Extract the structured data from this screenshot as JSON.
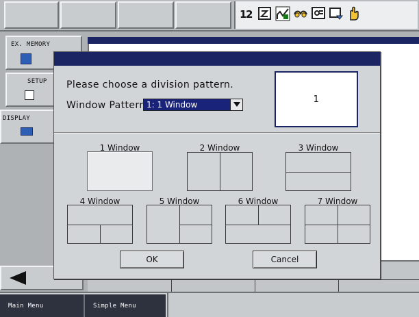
{
  "toolbar": {
    "icons": [
      "layout-icon",
      "checkbox-icon",
      "graph-icon",
      "glasses-icon",
      "display-icon",
      "window-icon",
      "hand-icon"
    ]
  },
  "sidebar": {
    "items": [
      {
        "label": "EX. MEMORY"
      },
      {
        "label": "SETUP"
      },
      {
        "label": "DISPLAY"
      }
    ]
  },
  "dialog": {
    "prompt": "Please choose a division pattern.",
    "pattern_label": "Window Pattern",
    "pattern_select": {
      "selected": "1: 1 Window"
    },
    "preview_value": "1",
    "patterns": [
      {
        "label": "1 Window"
      },
      {
        "label": "2 Window"
      },
      {
        "label": "3 Window"
      },
      {
        "label": "4 Window"
      },
      {
        "label": "5 Window"
      },
      {
        "label": "6 Window"
      },
      {
        "label": "7 Window"
      }
    ],
    "ok_label": "OK",
    "cancel_label": "Cancel"
  },
  "footer": {
    "main_menu_label": "Main Menu",
    "simple_menu_label": "Simple Menu"
  },
  "colors": {
    "accent": "#1c2564",
    "menu_bar": "#2e323f",
    "selection": "#1a237a"
  }
}
